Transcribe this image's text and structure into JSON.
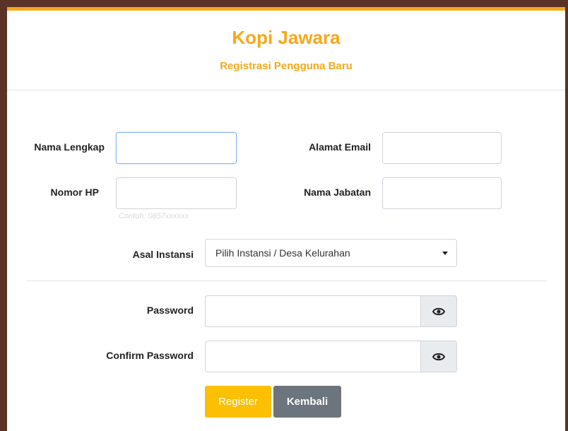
{
  "header": {
    "title": "Kopi Jawara",
    "subtitle": "Registrasi Pengguna Baru"
  },
  "form": {
    "full_name": {
      "label": "Nama Lengkap",
      "value": ""
    },
    "email": {
      "label": "Alamat Email",
      "value": ""
    },
    "phone": {
      "label": "Nomor HP",
      "value": "",
      "hint": "Contoh: 0857xxxxxx"
    },
    "position": {
      "label": "Nama Jabatan",
      "value": ""
    },
    "institution": {
      "label": "Asal Instansi",
      "selected": "Pilih Instansi / Desa Kelurahan"
    },
    "password": {
      "label": "Password",
      "value": ""
    },
    "confirm_password": {
      "label": "Confirm Password",
      "value": ""
    }
  },
  "buttons": {
    "register": "Register",
    "back": "Kembali"
  },
  "icons": {
    "password_toggle": "eye-icon",
    "dropdown": "caret-down-icon"
  },
  "colors": {
    "accent": "#f6a81a",
    "register_button": "#fbbf04",
    "back_button": "#6c757d",
    "background": "#5a3326"
  }
}
